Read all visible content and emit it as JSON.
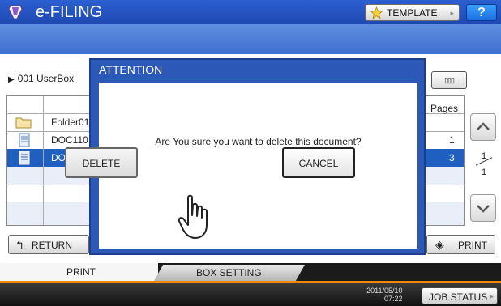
{
  "header": {
    "app_title": "e-FILING",
    "template_label": "TEMPLATE",
    "template_arrow": "▸",
    "help_label": "?"
  },
  "box": {
    "path": "001 UserBox",
    "layout_icon": "▯▯▯"
  },
  "table": {
    "pages_header": "Pages",
    "rows": [
      {
        "name": "Folder01",
        "pages": "",
        "icon": "folder-icon"
      },
      {
        "name": "DOC110",
        "pages": "1",
        "icon": "document-icon"
      },
      {
        "name": "DOC110",
        "pages": "3",
        "icon": "document-icon"
      }
    ]
  },
  "pager": {
    "current": "1",
    "total": "1"
  },
  "actions": {
    "return_label": "RETURN",
    "print_label": "PRINT"
  },
  "tabs": {
    "print_label": "PRINT",
    "box_setting_label": "BOX SETTING"
  },
  "status": {
    "date": "2011/05/10",
    "time": "07:22",
    "job_status_label": "JOB STATUS",
    "job_status_arrow": "▸"
  },
  "modal": {
    "title": "ATTENTION",
    "message": "Are You sure you want to delete this document?",
    "delete_label": "DELETE",
    "cancel_label": "CANCEL"
  },
  "colors": {
    "header_blue": "#1f49b3",
    "modal_blue": "#2c58b8",
    "selection_blue": "#1f5fbf",
    "tab_accent": "#f08a00"
  }
}
